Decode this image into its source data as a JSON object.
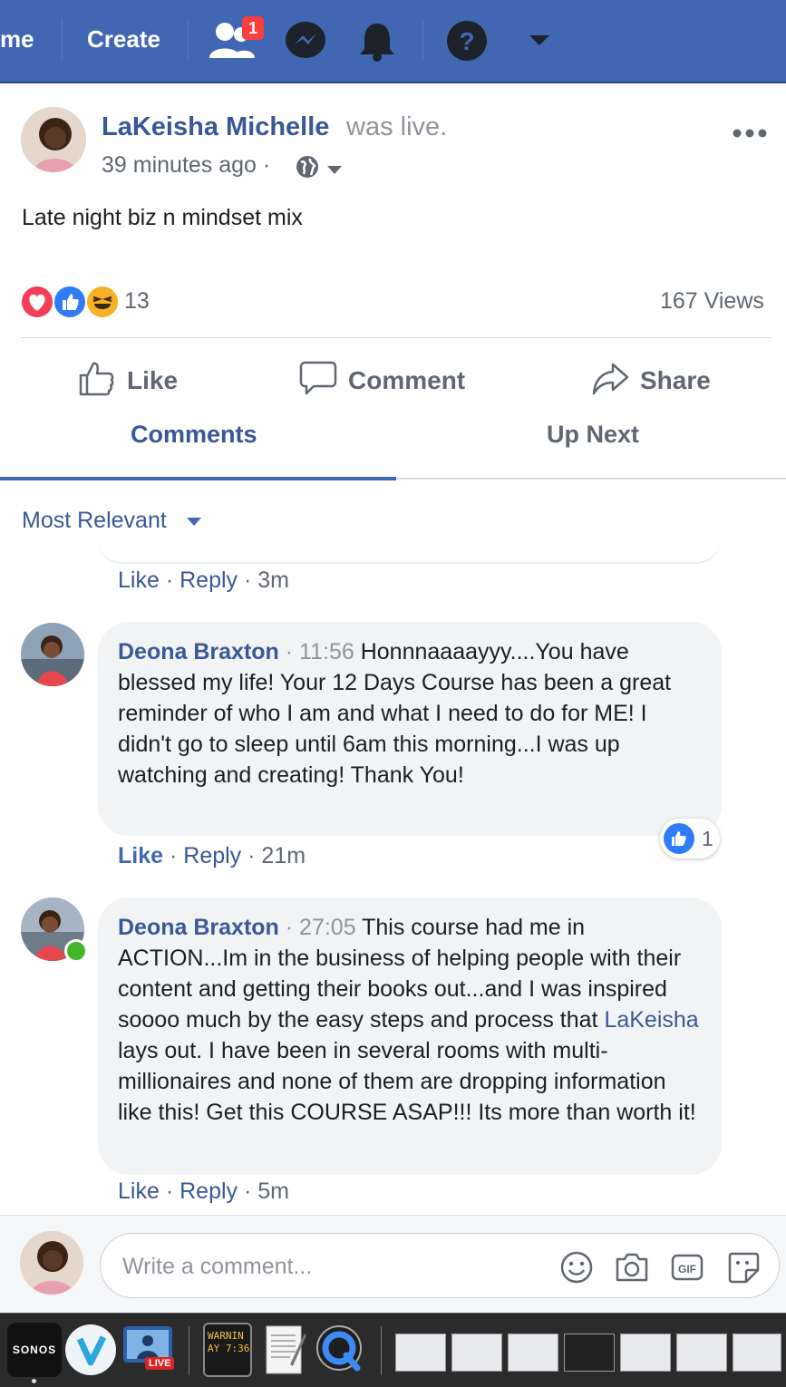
{
  "topbar": {
    "home_partial": "me",
    "create_label": "Create",
    "friend_requests_badge": "1"
  },
  "post": {
    "author": "LaKeisha Michelle",
    "action": "was live.",
    "time": "39 minutes ago ·",
    "text": "Late night biz n mindset mix",
    "reaction_count": "13",
    "views": "167 Views",
    "actions": {
      "like": "Like",
      "comment": "Comment",
      "share": "Share"
    }
  },
  "tabs": {
    "comments": "Comments",
    "up_next": "Up Next",
    "active": "comments"
  },
  "sort_label": "Most Relevant",
  "prev_comment_meta": {
    "like": "Like",
    "reply": "Reply",
    "time": "3m"
  },
  "comments": [
    {
      "name": "Deona Braxton",
      "timestamp": "11:56",
      "text": "Honnnaaaayyy....You have blessed my life! Your 12 Days Course has been a great reminder of who I am and what I need to do for ME! I didn't go to sleep until 6am this morning...I was up watching and creating! Thank You!",
      "like_count": "1",
      "meta": {
        "like": "Like",
        "reply": "Reply",
        "time": "21m"
      }
    },
    {
      "name": "Deona Braxton",
      "timestamp": "27:05",
      "text_before": "This course had me in ACTION...Im in the business of helping people with their content and getting their books out...and I was inspired soooo much by the easy steps and process that",
      "mention": "LaKeisha",
      "text_after": "lays out. I have been in several rooms with multi-millionaires and none of them are dropping information like this! Get this COURSE ASAP!!! Its more than worth it!",
      "meta": {
        "like": "Like",
        "reply": "Reply",
        "time": "5m"
      }
    }
  ],
  "composer": {
    "placeholder": "Write a comment..."
  },
  "dock": {
    "sonos_label": "SONOS",
    "live_label": "LIVE",
    "console_label": "WARNIN\nAY 7:36"
  },
  "colors": {
    "brand": "#4267b2",
    "link": "#385898",
    "online": "#42b72a",
    "badge": "#fa3e3e"
  }
}
